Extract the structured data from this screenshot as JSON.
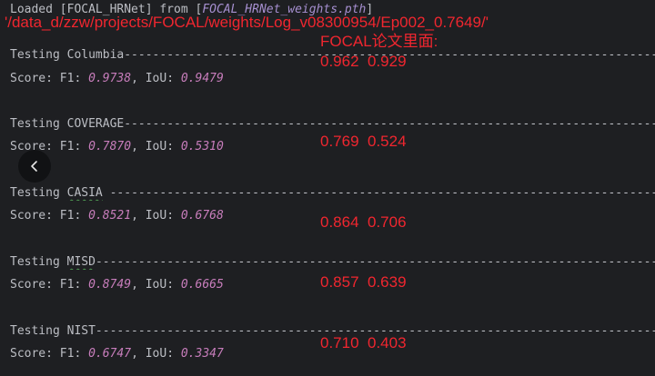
{
  "log": {
    "loaded_prefix": "Loaded [FOCAL_HRNet] from [",
    "loaded_file": "FOCAL_HRNet_weights.pth",
    "loaded_suffix": "]",
    "tests": [
      {
        "testing_line": "Testing Columbia",
        "dataset": "Columbia",
        "score_prefix": "Score: F1: ",
        "f1": "0.9738",
        "iou_label": ", IoU: ",
        "iou": "0.9479"
      },
      {
        "testing_line": "Testing COVERAGE",
        "dataset": "COVERAGE",
        "score_prefix": "Score: F1: ",
        "f1": "0.7870",
        "iou_label": ", IoU: ",
        "iou": "0.5310"
      },
      {
        "testing_line": "Testing CASIA ",
        "dataset": "CASIA",
        "score_prefix": "Score: F1: ",
        "f1": "0.8521",
        "iou_label": ", IoU: ",
        "iou": "0.6768"
      },
      {
        "testing_line": "Testing MISD",
        "dataset": "MISD",
        "score_prefix": "Score: F1: ",
        "f1": "0.8749",
        "iou_label": ", IoU: ",
        "iou": "0.6665"
      },
      {
        "testing_line": "Testing NIST",
        "dataset": "NIST",
        "score_prefix": "Score: F1: ",
        "f1": "0.6747",
        "iou_label": ", IoU: ",
        "iou": "0.3347"
      }
    ]
  },
  "annotations": {
    "path": "'/data_d/zzw/projects/FOCAL/weights/Log_v08300954/Ep002_0.7649/'",
    "paper_label": "FOCAL论文里面:",
    "paper_values": [
      "0.962  0.929",
      "0.769  0.524",
      "0.864  0.706",
      "0.857  0.639",
      "0.710  0.403"
    ]
  },
  "colors": {
    "background": "#1e1f22",
    "text": "#bcbec4",
    "number": "#c77dbb",
    "annotation_red": "#f0262f"
  },
  "icons": {
    "back": "chevron-left-icon"
  }
}
